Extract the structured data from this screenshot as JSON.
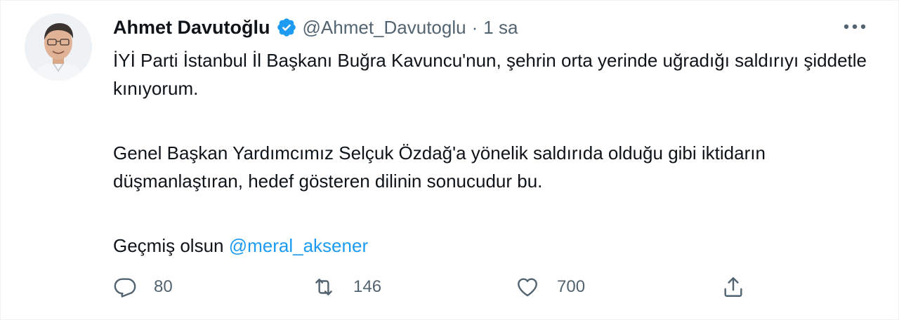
{
  "author": {
    "name": "Ahmet Davutoğlu",
    "handle": "@Ahmet_Davutoglu",
    "separator": "·",
    "time": "1 sa",
    "verified": true
  },
  "tweet": {
    "para1": "İYİ Parti İstanbul İl Başkanı Buğra Kavuncu'nun, şehrin orta yerinde uğradığı saldırıyı şiddetle kınıyorum.",
    "para2": "Genel Başkan Yardımcımız Selçuk Özdağ'a yönelik saldırıda olduğu gibi iktidarın düşmanlaştıran, hedef gösteren dilinin sonucudur bu.",
    "para3_prefix": "Geçmiş olsun ",
    "mention": "@meral_aksener"
  },
  "actions": {
    "reply_count": "80",
    "retweet_count": "146",
    "like_count": "700"
  },
  "colors": {
    "accent": "#1d9bf0",
    "secondary_text": "#536471",
    "primary_text": "#0f1419"
  },
  "icons": [
    "verified-badge-icon",
    "more-icon",
    "reply-icon",
    "retweet-icon",
    "like-icon",
    "share-icon"
  ]
}
